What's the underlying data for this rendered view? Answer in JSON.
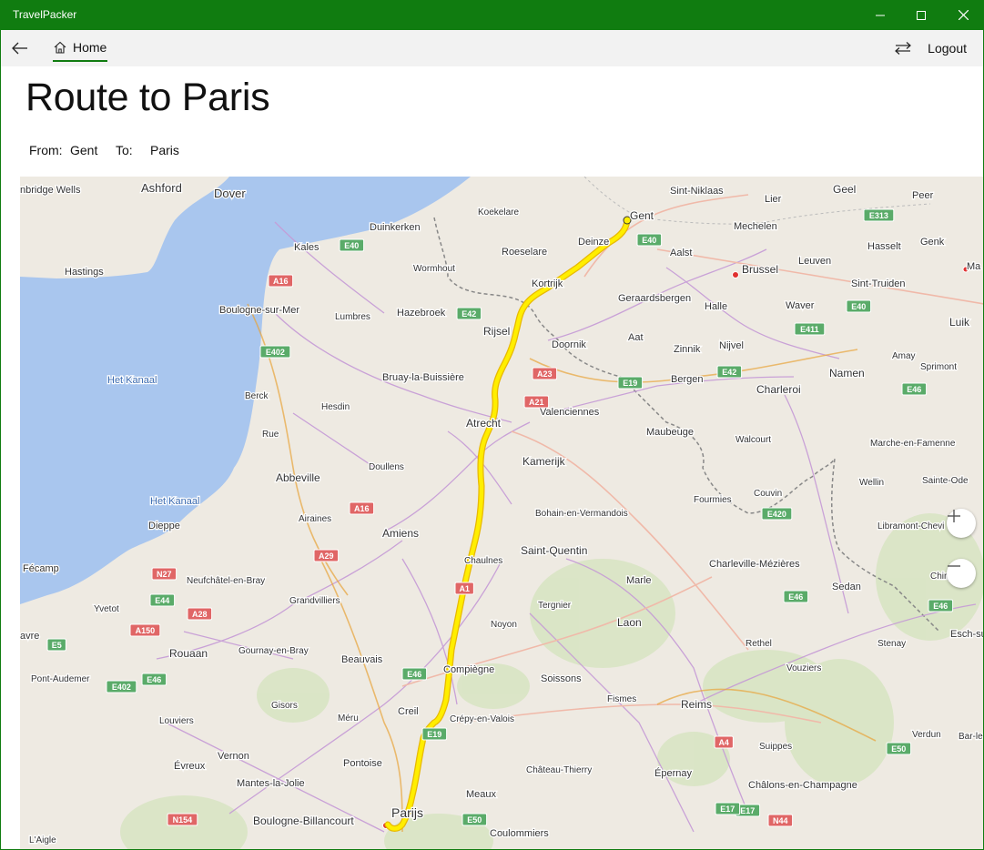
{
  "app": {
    "title": "TravelPacker"
  },
  "nav": {
    "home_label": "Home",
    "logout_label": "Logout"
  },
  "page": {
    "title": "Route to Paris"
  },
  "route": {
    "from_label": "From:",
    "from_value": "Gent",
    "to_label": "To:",
    "to_value": "Paris"
  },
  "map": {
    "colors": {
      "water": "#a9c6ee",
      "land": "#eeeae2",
      "route": "#ffee00",
      "motorway": "#5aab69",
      "road": "#c59ad6"
    },
    "labels": [
      "nbridge Wells",
      "Ashford",
      "Dover",
      "Kales",
      "Hastings",
      "Boulogne-sur-Mer",
      "Het Kanaal",
      "Het Kanaal",
      "Dieppe",
      "Fécamp",
      "Yvetot",
      "avre",
      "Pont-Audemer",
      "Rouaan",
      "Louviers",
      "Évreux",
      "Mantes-la-Jolie",
      "L'Aigle",
      "Duinkerken",
      "Wormhout",
      "Lumbres",
      "Hazebroek",
      "Berck",
      "Hesdin",
      "Rue",
      "Bruay-la-Buissière",
      "Abbeville",
      "Doullens",
      "Airaines",
      "Amiens",
      "Neufchâtel-en-Bray",
      "Grandvilliers",
      "Gournay-en-Bray",
      "Beauvais",
      "Gisors",
      "Méru",
      "Vernon",
      "Pontoise",
      "Boulogne-Billancourt",
      "Parijs",
      "Koekelare",
      "Roeselare",
      "Kortrijk",
      "Rijsel",
      "Doornik",
      "Atrecht",
      "Kamerijk",
      "Valenciennes",
      "Bohain-en-Vermandois",
      "Saint-Quentin",
      "Chaulnes",
      "Tergnier",
      "Noyon",
      "Compiègne",
      "Creil",
      "Crépy-en-Valois",
      "Soissons",
      "Château-Thierry",
      "Meaux",
      "Coulommiers",
      "Fismes",
      "Épernay",
      "Laon",
      "Marle",
      "Gent",
      "Deinze",
      "Sint-Niklaas",
      "Lier",
      "Geel",
      "Peer",
      "Mechelen",
      "Aalst",
      "Hasselt",
      "Genk",
      "Brussel",
      "Leuven",
      "Geraardsbergen",
      "Halle",
      "Waver",
      "Sint-Truiden",
      "Luik",
      "Aat",
      "Zinnik",
      "Nijvel",
      "Amay",
      "Sprimont",
      "Bergen",
      "Charleroi",
      "Namen",
      "Maubeuge",
      "Walcourt",
      "Marche-en-Famenne",
      "Fourmies",
      "Couvin",
      "Wellin",
      "Sainte-Ode",
      "Libramont-Chevi",
      "Charleville-Mézières",
      "Chiny",
      "Sedan",
      "Rethel",
      "Stenay",
      "Esch-sur",
      "Vouziers",
      "Reims",
      "Suippes",
      "Verdun",
      "Châlons-en-Champagne",
      "Bar-le-Duc",
      "Ma"
    ],
    "road_shields": [
      "E40",
      "A16",
      "E402",
      "A16",
      "A29",
      "N27",
      "E44",
      "A28",
      "A150",
      "E5",
      "E46",
      "E402",
      "N154",
      "E42",
      "A23",
      "A21",
      "E19",
      "A1",
      "E46",
      "E19",
      "E17",
      "E50",
      "A4",
      "E17",
      "N44",
      "E50",
      "E40",
      "E313",
      "E40",
      "E411",
      "E42",
      "E46",
      "E420",
      "E46",
      "E46"
    ]
  }
}
